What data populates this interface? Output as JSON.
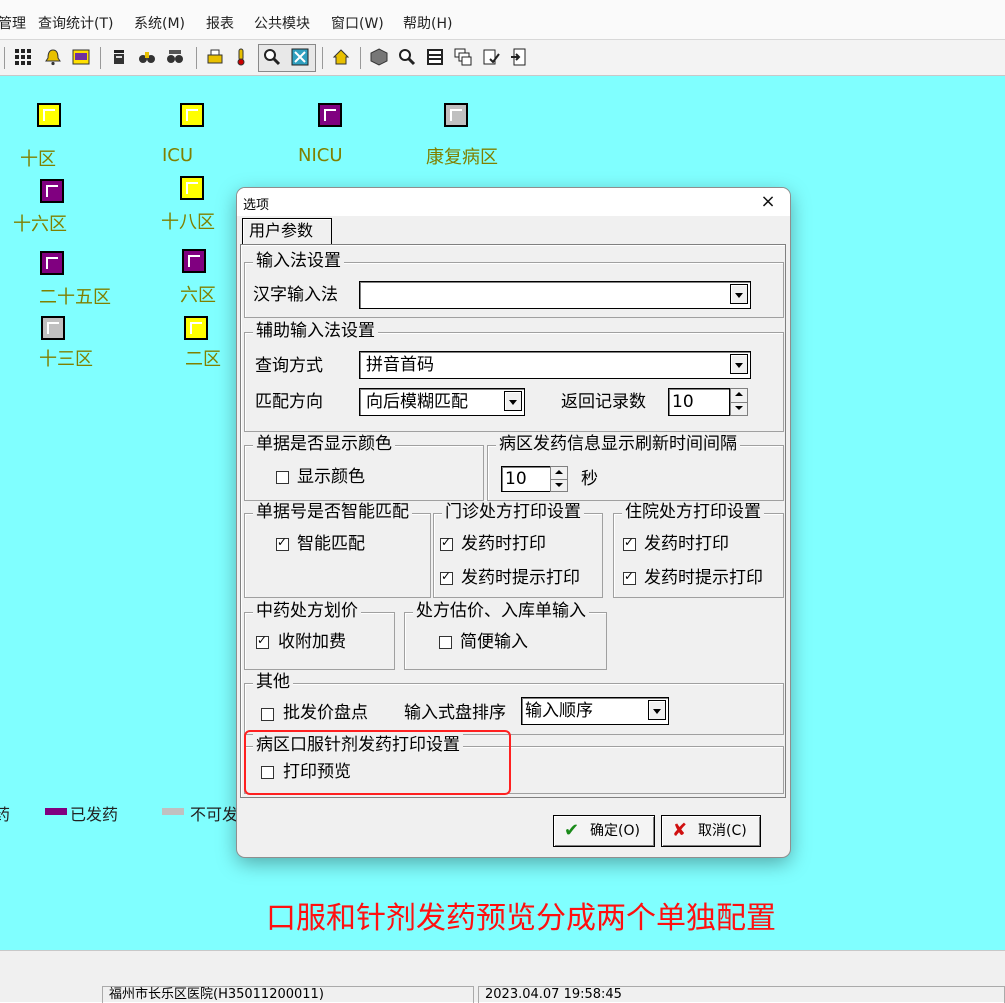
{
  "menubar": {
    "items": [
      "管理",
      "查询统计(T)",
      "系统(M)",
      "报表",
      "公共模块",
      "窗口(W)",
      "帮助(H)"
    ]
  },
  "toolbar": {
    "icons": [
      "grid-icon",
      "bell-icon",
      "pm-icon",
      "cup-icon",
      "binoculars-icon",
      "binoculars-2-icon",
      "printer-icon",
      "thermometer-icon",
      "zoom-icon",
      "calc-icon",
      "home-icon",
      "cube-icon",
      "search-icon",
      "list-icon",
      "stack-icon",
      "check-doc-icon",
      "exit-icon"
    ]
  },
  "wards": [
    {
      "name": "十区",
      "status": "yellow"
    },
    {
      "name": "ICU",
      "status": "yellow"
    },
    {
      "name": "NICU",
      "status": "purple"
    },
    {
      "name": "康复病区",
      "status": "gray"
    },
    {
      "name": "十六区",
      "status": "purple"
    },
    {
      "name": "十八区",
      "status": "yellow"
    },
    {
      "name": "二十五区",
      "status": "purple"
    },
    {
      "name": "六区",
      "status": "purple"
    },
    {
      "name": "十三区",
      "status": "gray"
    },
    {
      "name": "二区",
      "status": "yellow"
    }
  ],
  "legend": {
    "items": [
      {
        "label": "药",
        "color": "#ffff00"
      },
      {
        "label": "已发药",
        "color": "#800080"
      },
      {
        "label": "不可发",
        "color": "#c0c0c0"
      }
    ]
  },
  "dialog": {
    "title": "选项",
    "close": "×",
    "tab": "用户参数",
    "ime": {
      "group": "输入法设置",
      "label": "汉字输入法",
      "value": ""
    },
    "aux": {
      "group": "辅助输入法设置",
      "query_label": "查询方式",
      "query_value": "拼音首码",
      "match_label": "匹配方向",
      "match_value": "向后模糊匹配",
      "count_label": "返回记录数",
      "count_value": "10"
    },
    "color": {
      "group": "单据是否显示颜色",
      "checkbox": "显示颜色",
      "checked": false
    },
    "refresh": {
      "group": "病区发药信息显示刷新时间间隔",
      "value": "10",
      "unit": "秒"
    },
    "smart": {
      "group": "单据号是否智能匹配",
      "checkbox": "智能匹配",
      "checked": true
    },
    "outpatient": {
      "group": "门诊处方打印设置",
      "print": "发药时打印",
      "print_checked": true,
      "prompt": "发药时提示打印",
      "prompt_checked": true
    },
    "inpatient": {
      "group": "住院处方打印设置",
      "print": "发药时打印",
      "print_checked": true,
      "prompt": "发药时提示打印",
      "prompt_checked": true
    },
    "tcm": {
      "group": "中药处方划价",
      "checkbox": "收附加费",
      "checked": true
    },
    "estimate": {
      "group": "处方估价、入库单输入",
      "checkbox": "简便输入",
      "checked": false
    },
    "other": {
      "group": "其他",
      "checkbox": "批发价盘点",
      "checked": false,
      "sort_label": "输入式盘排序",
      "sort_value": "输入顺序"
    },
    "ward_print": {
      "group": "病区口服针剂发药打印设置",
      "checkbox": "打印预览",
      "checked": false
    },
    "ok": "确定(O)",
    "cancel": "取消(C)"
  },
  "annotation": "口服和针剂发药预览分成两个单独配置",
  "status": {
    "hospital": "福州市长乐区医院(H35011200011)",
    "datetime": "2023.04.07 19:58:45"
  },
  "colors": {
    "workspace": "#80ffff",
    "ward_label": "#808000",
    "annotation": "#ff1010",
    "highlight_box": "#ff2020"
  }
}
